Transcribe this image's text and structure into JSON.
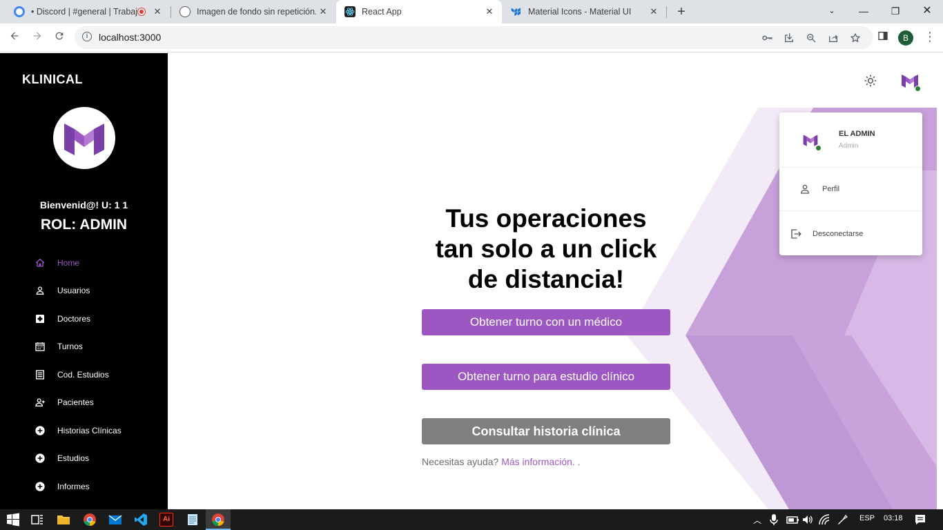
{
  "browser": {
    "tabs": [
      {
        "title": "• Discord | #general | Trabaj",
        "favicon": "discord-icon",
        "fav_color": "#5865f2"
      },
      {
        "title": "Imagen de fondo sin repetición.",
        "favicon": "openai-icon",
        "fav_color": "#7a7a7a"
      },
      {
        "title": "React App",
        "favicon": "react-icon",
        "fav_color": "#222"
      },
      {
        "title": "Material Icons - Material UI",
        "favicon": "mui-icon",
        "fav_color": "#1976d2"
      }
    ],
    "close_glyph": "✕",
    "new_tab_glyph": "+",
    "url": "localhost:3000",
    "profile_initial": "B"
  },
  "sidebar": {
    "brand": "KLINICAL",
    "welcome": "Bienvenid@! U: 1 1",
    "role": "ROL: ADMIN",
    "items": [
      {
        "label": "Home",
        "icon": "home-icon",
        "active": true
      },
      {
        "label": "Usuarios",
        "icon": "person-icon"
      },
      {
        "label": "Doctores",
        "icon": "medical-cross-icon"
      },
      {
        "label": "Turnos",
        "icon": "calendar-icon"
      },
      {
        "label": "Cod. Estudios",
        "icon": "list-icon"
      },
      {
        "label": "Pacientes",
        "icon": "person-add-icon"
      },
      {
        "label": "Historias Clínicas",
        "icon": "add-circle-icon"
      },
      {
        "label": "Estudios",
        "icon": "add-circle-icon"
      },
      {
        "label": "Informes",
        "icon": "add-circle-icon"
      }
    ]
  },
  "main": {
    "hero_line1": "Tus operaciones",
    "hero_line2": "tan solo a un click",
    "hero_line3": "de distancia!",
    "btn_medico": "Obtener turno con un médico",
    "btn_estudio": "Obtener turno para estudio clínico",
    "btn_historia": "Consultar historia clínica",
    "help_text": "Necesitas ayuda?",
    "help_link": "Más información. ."
  },
  "user_menu": {
    "name": "EL ADMIN",
    "role": "Admin",
    "items": [
      {
        "label": "Perfil",
        "icon": "person-outline-icon"
      },
      {
        "label": "Desconectarse",
        "icon": "logout-icon"
      }
    ]
  },
  "taskbar": {
    "language": "ESP",
    "time": "03:18"
  },
  "colors": {
    "accent": "#9c57c3",
    "sidebar_bg": "#000000",
    "grey_button": "#7f7f7f",
    "online": "#2e7d32"
  }
}
